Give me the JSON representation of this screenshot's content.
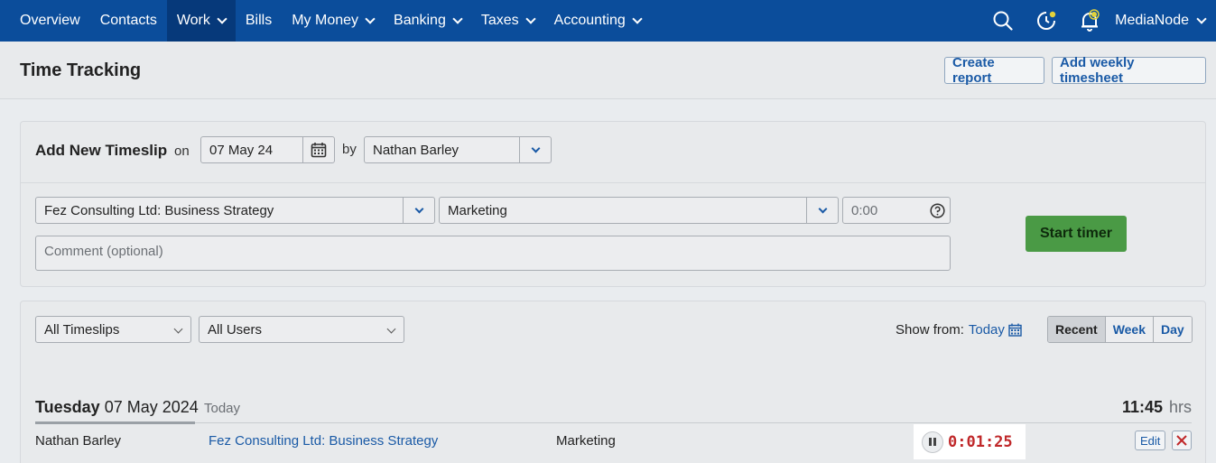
{
  "nav": {
    "items": [
      {
        "label": "Overview",
        "dropdown": false,
        "active": false
      },
      {
        "label": "Contacts",
        "dropdown": false,
        "active": false
      },
      {
        "label": "Work",
        "dropdown": true,
        "active": true
      },
      {
        "label": "Bills",
        "dropdown": false,
        "active": false
      },
      {
        "label": "My Money",
        "dropdown": true,
        "active": false
      },
      {
        "label": "Banking",
        "dropdown": true,
        "active": false
      },
      {
        "label": "Taxes",
        "dropdown": true,
        "active": false
      },
      {
        "label": "Accounting",
        "dropdown": true,
        "active": false
      }
    ],
    "account_label": "MediaNode",
    "icons": [
      "search-icon",
      "timer-clock-icon",
      "notification-bell-icon"
    ],
    "colors": {
      "bar": "#0b4d9b",
      "active": "#06397a",
      "badge": "#e3d23a"
    }
  },
  "page": {
    "title": "Time Tracking",
    "create_report_label": "Create report",
    "add_weekly_label": "Add weekly timesheet"
  },
  "new_timeslip": {
    "heading": "Add New Timeslip",
    "on_label": "on",
    "date_value": "07 May 24",
    "by_label": "by",
    "user_value": "Nathan Barley",
    "project_value": "Fez Consulting Ltd: Business Strategy",
    "task_value": "Marketing",
    "hours_placeholder": "0:00",
    "comment_placeholder": "Comment (optional)",
    "start_timer_label": "Start timer",
    "start_color": "#4a9a45"
  },
  "filters": {
    "timeslip_filter": "All Timeslips",
    "user_filter": "All Users",
    "show_from_label": "Show from:",
    "show_from_value": "Today",
    "views": [
      "Recent",
      "Week",
      "Day"
    ],
    "selected_view": "Recent"
  },
  "day": {
    "weekday": "Tuesday",
    "date": "07 May 2024",
    "tag": "Today",
    "total": "11:45",
    "unit": "hrs"
  },
  "entries": [
    {
      "user": "Nathan Barley",
      "project": "Fez Consulting Ltd: Business Strategy",
      "task": "Marketing",
      "timer": "0:01:25",
      "edit_label": "Edit",
      "timer_color": "#c0282a"
    }
  ]
}
